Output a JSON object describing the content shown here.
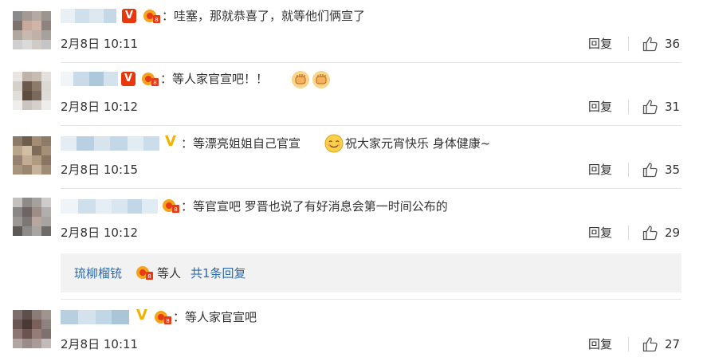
{
  "comments": [
    {
      "text": "：哇塞，那就恭喜了，就等他们俩宣了",
      "time": "2月8日 10:11",
      "reply": "回复",
      "likes": "36",
      "badge": "V"
    },
    {
      "text": "：等人家官宣吧！！",
      "time": "2月8日 10:12",
      "reply": "回复",
      "likes": "31",
      "badge": "V"
    },
    {
      "text": "：等漂亮姐姐自己官宣",
      "text2": "祝大家元宵快乐 身体健康~",
      "time": "2月8日 10:15",
      "reply": "回复",
      "likes": "35",
      "badge": "V"
    },
    {
      "text": "：等官宣吧 罗晋也说了有好消息会第一时间公布的",
      "time": "2月8日 10:12",
      "reply": "回复",
      "likes": "29"
    },
    {
      "text": "：等人家官宣吧",
      "time": "2月8日 10:11",
      "reply": "回复",
      "likes": "27",
      "badge": "V"
    }
  ],
  "subreply": {
    "user": "琉柳榴铳",
    "text": "等人",
    "more": "共1条回复"
  },
  "colors": {
    "link": "#2a6ab0",
    "vip_red": "#e8360d",
    "vip_gold": "#f3b100"
  },
  "icons": [
    "v-badge-icon",
    "fan-badge-icon",
    "fist-emoji-icon",
    "smile-emoji-icon",
    "thumbs-up-icon"
  ]
}
